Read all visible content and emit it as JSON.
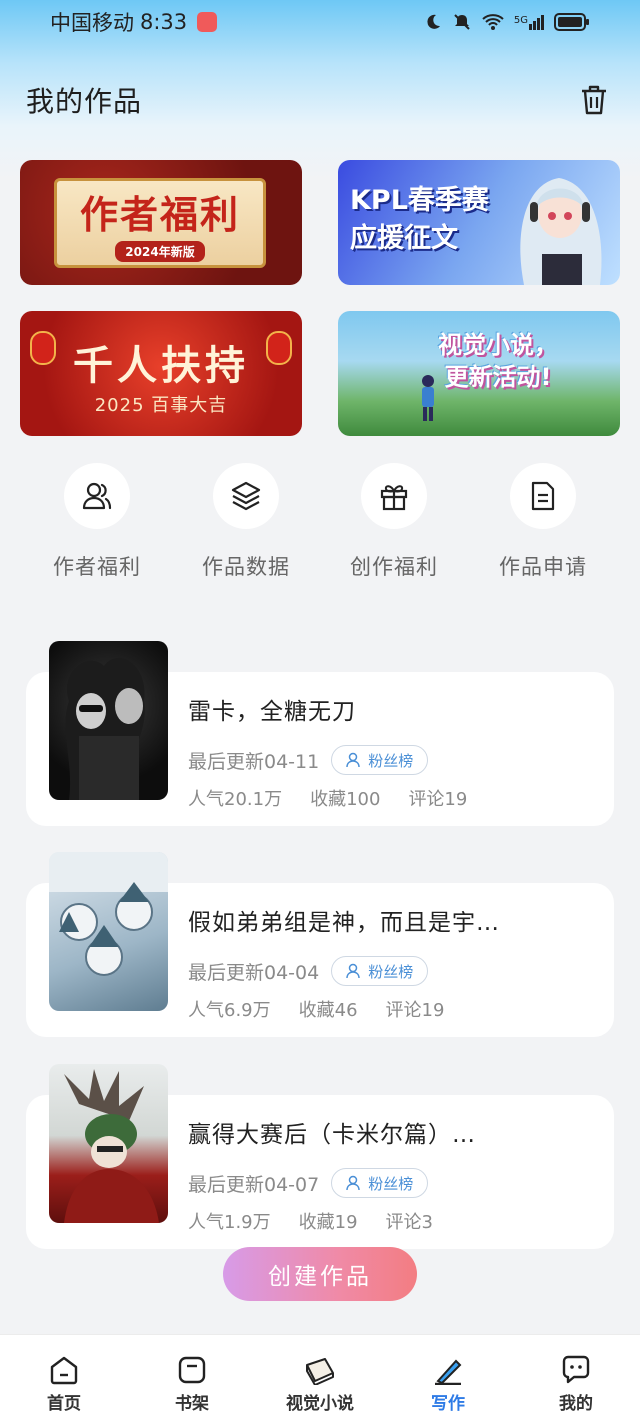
{
  "status_bar": {
    "carrier": "中国移动",
    "time": "8:33",
    "network": "5G"
  },
  "header": {
    "title": "我的作品"
  },
  "banners": [
    {
      "title": "作者福利",
      "tag": "2024年新版"
    },
    {
      "title_line1": "KPL春季赛",
      "title_line2": "应援征文"
    },
    {
      "title": "千人扶持",
      "subtitle": "2025 百事大吉"
    },
    {
      "title_line1": "视觉小说，",
      "title_line2": "更新活动!"
    }
  ],
  "quick_actions": [
    {
      "label": "作者福利",
      "icon": "users-icon"
    },
    {
      "label": "作品数据",
      "icon": "layers-icon"
    },
    {
      "label": "创作福利",
      "icon": "gift-icon"
    },
    {
      "label": "作品申请",
      "icon": "document-icon"
    }
  ],
  "works": [
    {
      "title": "雷卡，全糖无刀",
      "updated": "最后更新04-11",
      "badge": "粉丝榜",
      "popularity": "人气20.1万",
      "favorites": "收藏100",
      "comments": "评论19"
    },
    {
      "title": "假如弟弟组是神，而且是宇…",
      "updated": "最后更新04-04",
      "badge": "粉丝榜",
      "popularity": "人气6.9万",
      "favorites": "收藏46",
      "comments": "评论19"
    },
    {
      "title": "赢得大赛后（卡米尔篇）…",
      "updated": "最后更新04-07",
      "badge": "粉丝榜",
      "popularity": "人气1.9万",
      "favorites": "收藏19",
      "comments": "评论3"
    }
  ],
  "create_button": {
    "label": "创建作品"
  },
  "bottom_nav": [
    {
      "label": "首页",
      "icon": "home-icon"
    },
    {
      "label": "书架",
      "icon": "bookshelf-icon"
    },
    {
      "label": "视觉小说",
      "icon": "book-icon"
    },
    {
      "label": "写作",
      "icon": "pen-icon",
      "active": true
    },
    {
      "label": "我的",
      "icon": "chat-icon"
    }
  ],
  "colors": {
    "accent": "#2e7be6",
    "create_gradient_start": "#d79be8",
    "create_gradient_end": "#f37d82"
  }
}
